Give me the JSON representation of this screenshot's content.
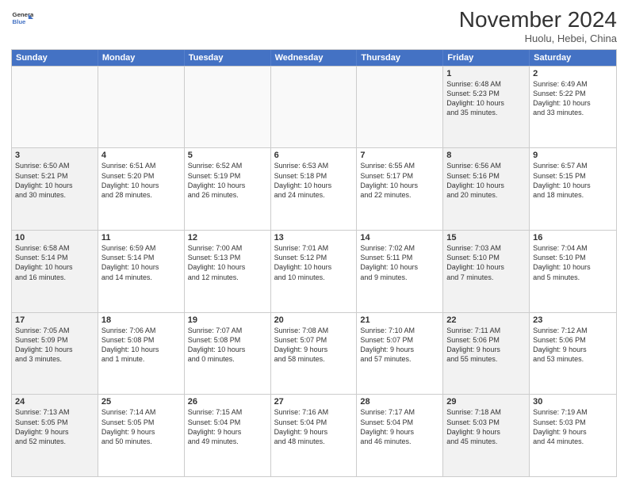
{
  "logo": {
    "line1": "General",
    "line2": "Blue"
  },
  "title": "November 2024",
  "location": "Huolu, Hebei, China",
  "days_of_week": [
    "Sunday",
    "Monday",
    "Tuesday",
    "Wednesday",
    "Thursday",
    "Friday",
    "Saturday"
  ],
  "rows": [
    [
      {
        "day": "",
        "info": "",
        "empty": true
      },
      {
        "day": "",
        "info": "",
        "empty": true
      },
      {
        "day": "",
        "info": "",
        "empty": true
      },
      {
        "day": "",
        "info": "",
        "empty": true
      },
      {
        "day": "",
        "info": "",
        "empty": true
      },
      {
        "day": "1",
        "info": "Sunrise: 6:48 AM\nSunset: 5:23 PM\nDaylight: 10 hours\nand 35 minutes.",
        "shaded": true
      },
      {
        "day": "2",
        "info": "Sunrise: 6:49 AM\nSunset: 5:22 PM\nDaylight: 10 hours\nand 33 minutes.",
        "shaded": false
      }
    ],
    [
      {
        "day": "3",
        "info": "Sunrise: 6:50 AM\nSunset: 5:21 PM\nDaylight: 10 hours\nand 30 minutes.",
        "shaded": true
      },
      {
        "day": "4",
        "info": "Sunrise: 6:51 AM\nSunset: 5:20 PM\nDaylight: 10 hours\nand 28 minutes.",
        "shaded": false
      },
      {
        "day": "5",
        "info": "Sunrise: 6:52 AM\nSunset: 5:19 PM\nDaylight: 10 hours\nand 26 minutes.",
        "shaded": false
      },
      {
        "day": "6",
        "info": "Sunrise: 6:53 AM\nSunset: 5:18 PM\nDaylight: 10 hours\nand 24 minutes.",
        "shaded": false
      },
      {
        "day": "7",
        "info": "Sunrise: 6:55 AM\nSunset: 5:17 PM\nDaylight: 10 hours\nand 22 minutes.",
        "shaded": false
      },
      {
        "day": "8",
        "info": "Sunrise: 6:56 AM\nSunset: 5:16 PM\nDaylight: 10 hours\nand 20 minutes.",
        "shaded": true
      },
      {
        "day": "9",
        "info": "Sunrise: 6:57 AM\nSunset: 5:15 PM\nDaylight: 10 hours\nand 18 minutes.",
        "shaded": false
      }
    ],
    [
      {
        "day": "10",
        "info": "Sunrise: 6:58 AM\nSunset: 5:14 PM\nDaylight: 10 hours\nand 16 minutes.",
        "shaded": true
      },
      {
        "day": "11",
        "info": "Sunrise: 6:59 AM\nSunset: 5:14 PM\nDaylight: 10 hours\nand 14 minutes.",
        "shaded": false
      },
      {
        "day": "12",
        "info": "Sunrise: 7:00 AM\nSunset: 5:13 PM\nDaylight: 10 hours\nand 12 minutes.",
        "shaded": false
      },
      {
        "day": "13",
        "info": "Sunrise: 7:01 AM\nSunset: 5:12 PM\nDaylight: 10 hours\nand 10 minutes.",
        "shaded": false
      },
      {
        "day": "14",
        "info": "Sunrise: 7:02 AM\nSunset: 5:11 PM\nDaylight: 10 hours\nand 9 minutes.",
        "shaded": false
      },
      {
        "day": "15",
        "info": "Sunrise: 7:03 AM\nSunset: 5:10 PM\nDaylight: 10 hours\nand 7 minutes.",
        "shaded": true
      },
      {
        "day": "16",
        "info": "Sunrise: 7:04 AM\nSunset: 5:10 PM\nDaylight: 10 hours\nand 5 minutes.",
        "shaded": false
      }
    ],
    [
      {
        "day": "17",
        "info": "Sunrise: 7:05 AM\nSunset: 5:09 PM\nDaylight: 10 hours\nand 3 minutes.",
        "shaded": true
      },
      {
        "day": "18",
        "info": "Sunrise: 7:06 AM\nSunset: 5:08 PM\nDaylight: 10 hours\nand 1 minute.",
        "shaded": false
      },
      {
        "day": "19",
        "info": "Sunrise: 7:07 AM\nSunset: 5:08 PM\nDaylight: 10 hours\nand 0 minutes.",
        "shaded": false
      },
      {
        "day": "20",
        "info": "Sunrise: 7:08 AM\nSunset: 5:07 PM\nDaylight: 9 hours\nand 58 minutes.",
        "shaded": false
      },
      {
        "day": "21",
        "info": "Sunrise: 7:10 AM\nSunset: 5:07 PM\nDaylight: 9 hours\nand 57 minutes.",
        "shaded": false
      },
      {
        "day": "22",
        "info": "Sunrise: 7:11 AM\nSunset: 5:06 PM\nDaylight: 9 hours\nand 55 minutes.",
        "shaded": true
      },
      {
        "day": "23",
        "info": "Sunrise: 7:12 AM\nSunset: 5:06 PM\nDaylight: 9 hours\nand 53 minutes.",
        "shaded": false
      }
    ],
    [
      {
        "day": "24",
        "info": "Sunrise: 7:13 AM\nSunset: 5:05 PM\nDaylight: 9 hours\nand 52 minutes.",
        "shaded": true
      },
      {
        "day": "25",
        "info": "Sunrise: 7:14 AM\nSunset: 5:05 PM\nDaylight: 9 hours\nand 50 minutes.",
        "shaded": false
      },
      {
        "day": "26",
        "info": "Sunrise: 7:15 AM\nSunset: 5:04 PM\nDaylight: 9 hours\nand 49 minutes.",
        "shaded": false
      },
      {
        "day": "27",
        "info": "Sunrise: 7:16 AM\nSunset: 5:04 PM\nDaylight: 9 hours\nand 48 minutes.",
        "shaded": false
      },
      {
        "day": "28",
        "info": "Sunrise: 7:17 AM\nSunset: 5:04 PM\nDaylight: 9 hours\nand 46 minutes.",
        "shaded": false
      },
      {
        "day": "29",
        "info": "Sunrise: 7:18 AM\nSunset: 5:03 PM\nDaylight: 9 hours\nand 45 minutes.",
        "shaded": true
      },
      {
        "day": "30",
        "info": "Sunrise: 7:19 AM\nSunset: 5:03 PM\nDaylight: 9 hours\nand 44 minutes.",
        "shaded": false
      }
    ]
  ]
}
